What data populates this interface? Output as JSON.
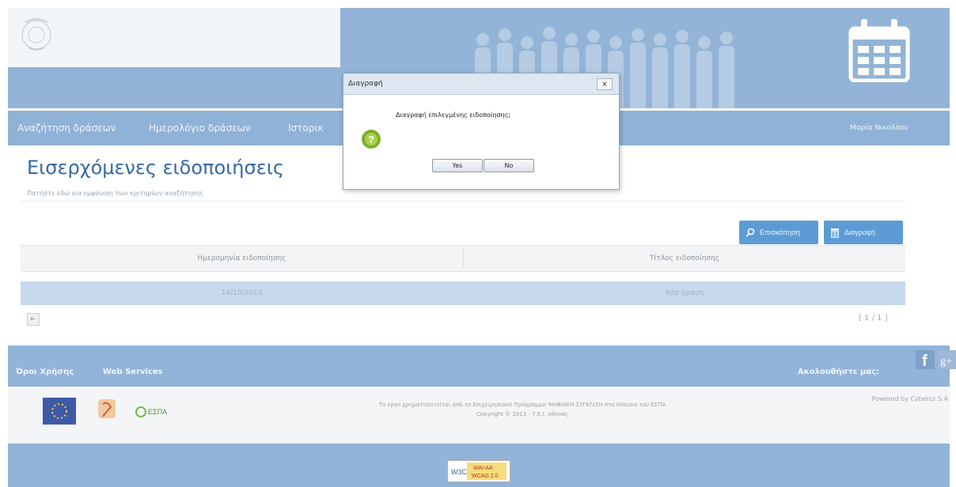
{
  "nav": {
    "items": [
      "Αναζήτηση δράσεων",
      "Ημερολόγιο δράσεων",
      "Ιστορικ"
    ],
    "user": "Μαρία Νικολάου"
  },
  "page": {
    "title": "Εισερχόμενες ειδοποιήσεις",
    "subtitle": "Πατήστε εδώ για εμφάνιση των κριτηρίων αναζήτησης"
  },
  "toolbar": {
    "search_label": "Επισκόπηση",
    "delete_label": "Διαγραφή"
  },
  "grid": {
    "columns": [
      "Ημερομηνία ειδοποίησης",
      "Τίτλος ειδοποίησης"
    ],
    "rows": [
      [
        "14/10/2013",
        "Νέα δράση"
      ]
    ],
    "pager_count": "[ 1 / 1 ]"
  },
  "footer": {
    "links": [
      "Όροι Χρήσης",
      "Web Services"
    ],
    "follow_label": "Ακολουθήστε μας:",
    "text_line1": "Το έργο χρηματοδοτείται από το Επιχειρησιακό Πρόγραμμα ΨΗΦΙΑΚΗ ΣΥΓΚΛΙΣΗ στο πλαίσιο του ΕΣΠΑ",
    "text_line2": "Copyright © 2013 - Τ.Ε.Ι. Αθήνας",
    "powered": "Powered by Cybercs S.A",
    "espa_label": "ΕΣΠΑ",
    "wcag_top": "WAI-AA",
    "wcag_bottom": "WCAG 2.0",
    "wcag_prefix": "W3C"
  },
  "dialog": {
    "title": "Διαγραφή",
    "message": "Διαγραφή επιλεγμένης ειδοποίησης;",
    "yes_label": "Yes",
    "no_label": "No",
    "close_label": "×"
  },
  "colors": {
    "header_blue": "#93b4d7",
    "title_blue": "#3569a4",
    "button_blue": "#5c9bd6",
    "selected_row": "#c7d9ec"
  }
}
